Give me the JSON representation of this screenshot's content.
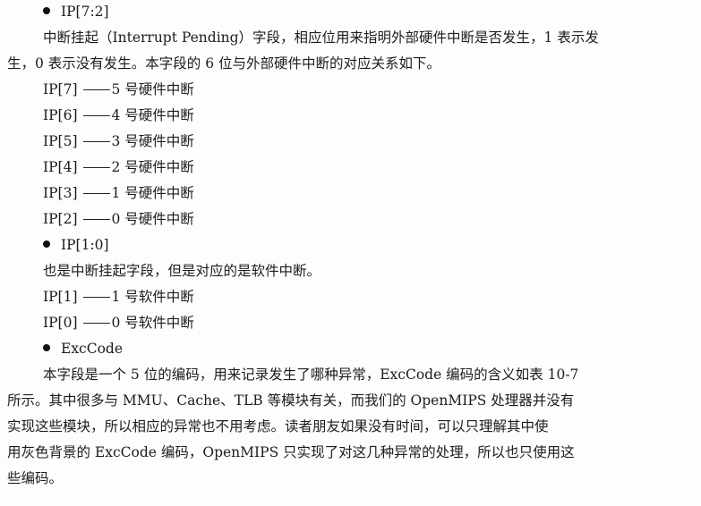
{
  "section_ip72": {
    "heading": "IP[7:2]",
    "desc_line1": "中断挂起（Interrupt Pending）字段，相应位用来指明外部硬件中断是否发生，1 表示发",
    "desc_line2": "生，0 表示没有发生。本字段的 6 位与外部硬件中断的对应关系如下。",
    "mappings": [
      {
        "bit": "IP[7]",
        "text": "5 号硬件中断"
      },
      {
        "bit": "IP[6]",
        "text": "4 号硬件中断"
      },
      {
        "bit": "IP[5]",
        "text": "3 号硬件中断"
      },
      {
        "bit": "IP[4]",
        "text": "2 号硬件中断"
      },
      {
        "bit": "IP[3]",
        "text": "1 号硬件中断"
      },
      {
        "bit": "IP[2]",
        "text": "0 号硬件中断"
      }
    ]
  },
  "section_ip10": {
    "heading": "IP[1:0]",
    "desc_line1": "也是中断挂起字段，但是对应的是软件中断。",
    "mappings": [
      {
        "bit": "IP[1]",
        "text": "1 号软件中断"
      },
      {
        "bit": "IP[0]",
        "text": "0 号软件中断"
      }
    ]
  },
  "section_exccode": {
    "heading": "ExcCode",
    "para_line1": "本字段是一个 5 位的编码，用来记录发生了哪种异常，ExcCode 编码的含义如表 10-7",
    "para_line2": "所示。其中很多与 MMU、Cache、TLB 等模块有关，而我们的 OpenMIPS 处理器并没有",
    "para_line3": "实现这些模块，所以相应的异常也不用考虑。读者朋友如果没有时间，可以只理解其中使",
    "para_line4": "用灰色背景的 ExcCode 编码，OpenMIPS 只实现了对这几种异常的处理，所以也只使用这",
    "para_line5": "些编码。"
  }
}
